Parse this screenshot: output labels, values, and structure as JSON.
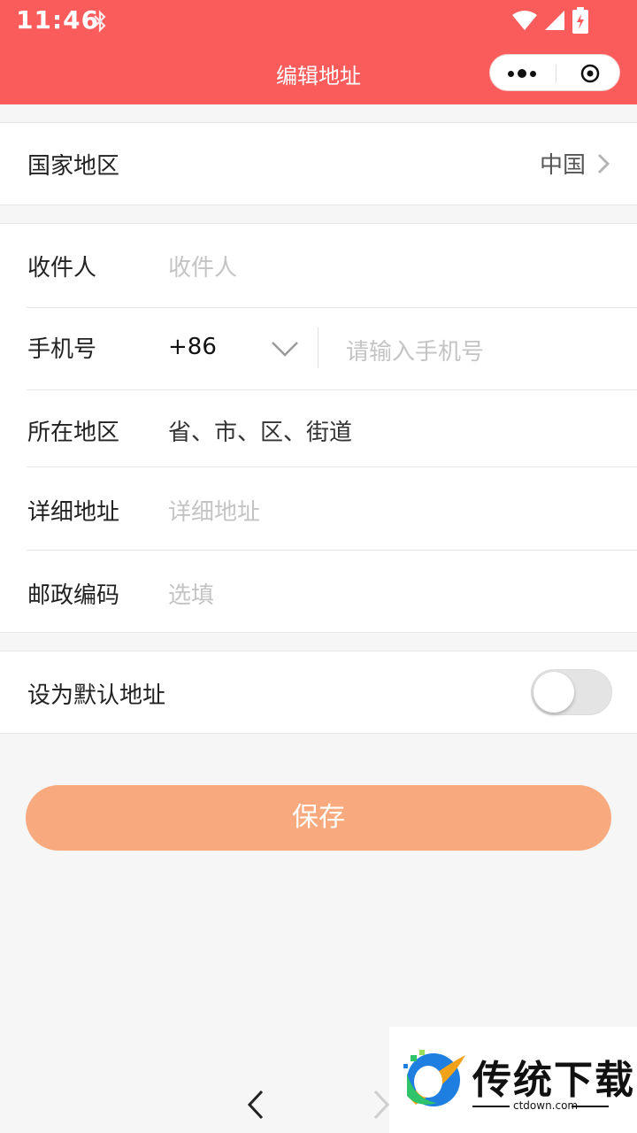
{
  "status_bar": {
    "time": "11:46"
  },
  "nav": {
    "title": "编辑地址"
  },
  "country_section": {
    "label": "国家地区",
    "value": "中国"
  },
  "form": {
    "recipient": {
      "label": "收件人",
      "placeholder": "收件人"
    },
    "phone": {
      "label": "手机号",
      "country_code": "+86",
      "placeholder": "请输入手机号"
    },
    "region": {
      "label": "所在地区",
      "value": "省、市、区、街道"
    },
    "detail": {
      "label": "详细地址",
      "placeholder": "详细地址"
    },
    "postcode": {
      "label": "邮政编码",
      "placeholder": "选填"
    }
  },
  "default_section": {
    "label": "设为默认地址",
    "toggle_on": false
  },
  "save_button": {
    "label": "保存"
  },
  "watermark": {
    "title": "传统下载",
    "subtitle": "ctdown.com"
  },
  "colors": {
    "header": "#fa5c5c",
    "save_button": "#f8a97e",
    "background": "#f6f6f6"
  }
}
